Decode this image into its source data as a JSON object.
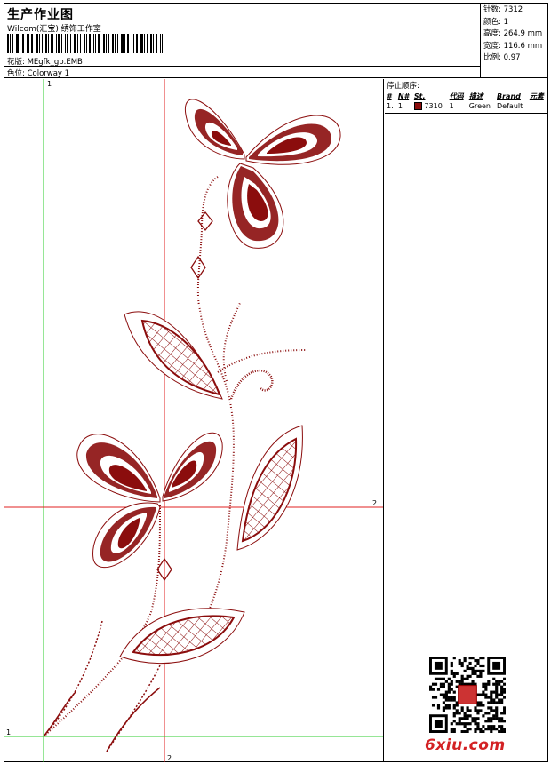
{
  "header": {
    "title": "生产作业图",
    "company": "Wilcom(汇宝) 绣饰工作室",
    "design_label": "花版:",
    "design_value": "MEgfk_gp.EMB",
    "colorway_label": "色位:",
    "colorway_value": "Colorway 1"
  },
  "stats": [
    {
      "label": "针数:",
      "value": "7312"
    },
    {
      "label": "颜色:",
      "value": "1"
    },
    {
      "label": "高度:",
      "value": "264.9 mm"
    },
    {
      "label": "宽度:",
      "value": "116.6 mm"
    },
    {
      "label": "比例:",
      "value": "0.97"
    }
  ],
  "guides": {
    "v1": "1",
    "v2": "2",
    "h1": "1",
    "h2": "2"
  },
  "stop_sequence": {
    "title": "停止顺序:",
    "columns": [
      "#",
      "N#",
      "St.",
      "代码",
      "描述",
      "Brand",
      "元素"
    ],
    "rows": [
      {
        "idx": "1.",
        "n": "1",
        "st": "7310",
        "code": "1",
        "desc": "Green",
        "brand": "Default",
        "elem": ""
      }
    ]
  },
  "colors": {
    "thread": "#8b0d0d",
    "guide_green": "#2ecc2e",
    "guide_red": "#e02020",
    "brand": "#d32224"
  },
  "watermark": "6xiu.com"
}
